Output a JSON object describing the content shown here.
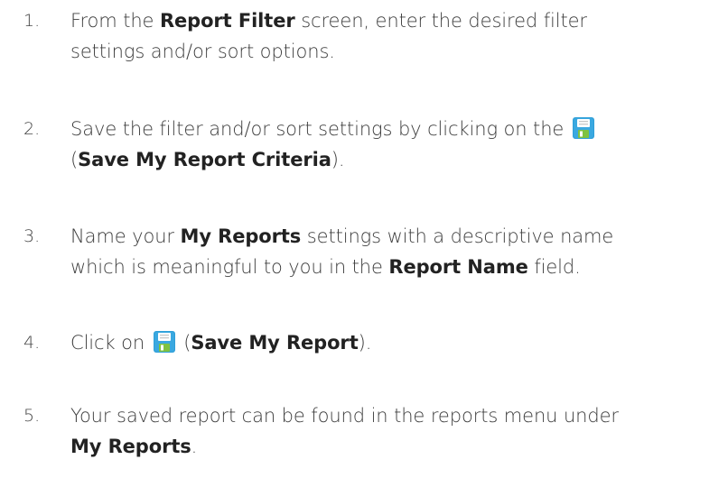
{
  "steps": [
    {
      "number": "1.",
      "t1": "From the ",
      "b1": "Report Filter",
      "t2": " screen, enter the desired filter",
      "t3": "settings and/or sort options."
    },
    {
      "number": "2.",
      "t1": "Save the filter and/or sort settings by clicking on the",
      "icon": "floppy-disk-save-icon",
      "t2": "(",
      "b1": "Save My Report Criteria",
      "t3": ")."
    },
    {
      "number": "3.",
      "t1": "Name your ",
      "b1": "My Reports",
      "t2": " settings with a descriptive name",
      "t3": "which is meaningful to you in the ",
      "b2": "Report Name",
      "t4": " field."
    },
    {
      "number": "4.",
      "t1": "Click on",
      "icon": "floppy-disk-save-icon",
      "t2": "(",
      "b1": "Save My Report",
      "t3": ")."
    },
    {
      "number": "5.",
      "t1": "Your saved report can be found in the reports menu under",
      "b1": "My Reports",
      "t2": "."
    }
  ],
  "colors": {
    "text": "#3d3d3d",
    "bold": "#222222",
    "icon_body": "#2f9fd8",
    "icon_label": "#ffffff",
    "icon_shutter": "#7fc241"
  }
}
